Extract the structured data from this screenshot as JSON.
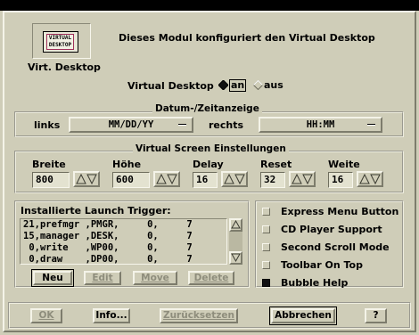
{
  "module": {
    "logo_line1": "VIRTUAL",
    "logo_line2": "DESKTOP",
    "description": "Dieses Modul konfiguriert den Virtual Desktop",
    "name": "Virt. Desktop"
  },
  "virtual_desktop": {
    "label": "Virtual Desktop",
    "option_on": "an",
    "option_off": "aus",
    "selected": "an"
  },
  "date_time": {
    "legend": "Datum-/Zeitanzeige",
    "left_label": "links",
    "left_value": "MM/DD/YY",
    "right_label": "rechts",
    "right_value": "HH:MM"
  },
  "screen": {
    "legend": "Virtual Screen Einstellungen",
    "fields": [
      {
        "label": "Breite",
        "value": "800"
      },
      {
        "label": "Höhe",
        "value": "600"
      },
      {
        "label": "Delay",
        "value": "16"
      },
      {
        "label": "Reset",
        "value": "32"
      },
      {
        "label": "Weite",
        "value": "16"
      }
    ]
  },
  "triggers": {
    "label": "Installierte Launch Trigger:",
    "rows": [
      "21,prefmgr ,PMGR,     0,     7",
      "15,manager ,DESK,     0,     7",
      " 0,write   ,WP00,     0,     7",
      " 0,draw    ,DP00,     0,     7"
    ],
    "buttons": [
      {
        "label": "Neu",
        "enabled": true
      },
      {
        "label": "Edit",
        "enabled": false
      },
      {
        "label": "Move",
        "enabled": false
      },
      {
        "label": "Delete",
        "enabled": false
      }
    ]
  },
  "options": [
    {
      "label": "Express Menu Button",
      "checked": false
    },
    {
      "label": "CD Player Support",
      "checked": false
    },
    {
      "label": "Second Scroll Mode",
      "checked": false
    },
    {
      "label": "Toolbar On Top",
      "checked": false
    },
    {
      "label": "Bubble Help",
      "checked": true
    }
  ],
  "footer": {
    "ok": "OK",
    "info": "Info...",
    "reset": "Zurücksetzen",
    "cancel": "Abbrechen",
    "help": "?"
  }
}
